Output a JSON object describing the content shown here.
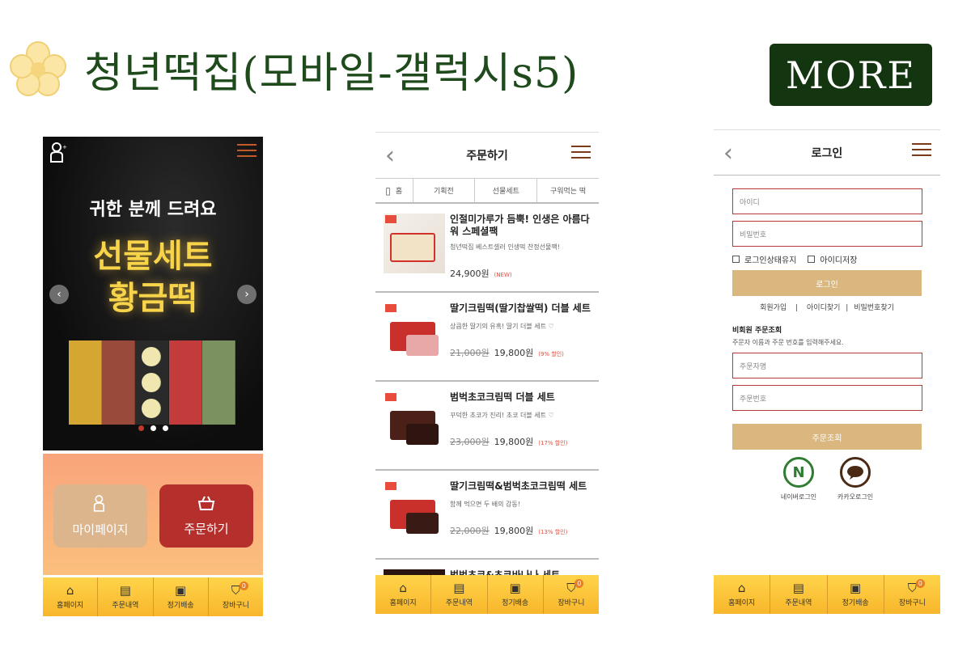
{
  "header": {
    "title": "청년떡집(모바일-갤럭시s5)",
    "more_label": "MORE"
  },
  "bottom_nav": [
    {
      "icon": "store-icon",
      "label": "홈페이지"
    },
    {
      "icon": "receipt-icon",
      "label": "주문내역"
    },
    {
      "icon": "box-icon",
      "label": "정기배송"
    },
    {
      "icon": "cart-icon",
      "label": "장바구니",
      "badge": "0"
    }
  ],
  "phone1": {
    "hero_sub": "귀한 분께 드려요",
    "hero_main_line1": "선물세트",
    "hero_main_line2": "황금떡",
    "prev_arrow": "‹",
    "next_arrow": "›",
    "slides": 3,
    "active_slide": 1,
    "tiles": [
      {
        "label": "마이페이지",
        "icon": "person-icon",
        "color": "#dcb58d"
      },
      {
        "label": "주문하기",
        "icon": "basket-icon",
        "color": "#b5302c"
      }
    ]
  },
  "phone2": {
    "title": "주문하기",
    "tabs": [
      "홈",
      "기획전",
      "선물세트",
      "구워먹는 떡"
    ],
    "products": [
      {
        "name": "인절미가루가 듬뿍! 인생은 아름다워 스페셜팩",
        "desc": "청년떡집 베스트셀러 인생떡 찬정선물팩!",
        "price": "24,900원",
        "old_price": "",
        "tag": "(NEW)"
      },
      {
        "name": "딸기크림떡(딸기찹쌀떡) 더블 세트",
        "desc": "상큼한 딸기의 유혹! 딸기 더블 세트 ♡",
        "price": "19,800원",
        "old_price": "21,000원",
        "tag": "(9% 할인)"
      },
      {
        "name": "범벅초코크림떡 더블 세트",
        "desc": "꾸덕한 초코가 진리! 초코 더블 세트 ♡",
        "price": "19,800원",
        "old_price": "23,000원",
        "tag": "(17% 할인)"
      },
      {
        "name": "딸기크림떡&범벅초코크림떡 세트",
        "desc": "함께 먹으면 두 배의 감동!",
        "price": "19,800원",
        "old_price": "22,000원",
        "tag": "(13% 할인)"
      },
      {
        "name": "범벅초코&초코바나나 세트",
        "desc": "",
        "price": "",
        "old_price": "",
        "tag": ""
      }
    ]
  },
  "phone3": {
    "title": "로그인",
    "id_placeholder": "아이디",
    "pw_placeholder": "비밀번호",
    "keep_login": "로그인상태유지",
    "save_id": "아이디저장",
    "login_btn": "로그인",
    "link_join": "회원가입",
    "link_find_id": "아이디찾기",
    "link_find_pw": "비밀번호찾기",
    "link_sep": "|",
    "guest_title": "비회원 주문조회",
    "guest_desc": "주문자 이름과 주문 번호를 입력해주세요.",
    "orderer_placeholder": "주문자명",
    "order_no_placeholder": "주문번호",
    "order_lookup_btn": "주문조회",
    "naver_login": "네이버로그인",
    "kakao_login": "카카오로그인"
  },
  "colors": {
    "title_green": "#1e4a1c",
    "more_bg": "#13350f",
    "nav_yellow": "#f8c12e",
    "gold_button": "#d9b77f",
    "accent_red": "#b5302c"
  }
}
